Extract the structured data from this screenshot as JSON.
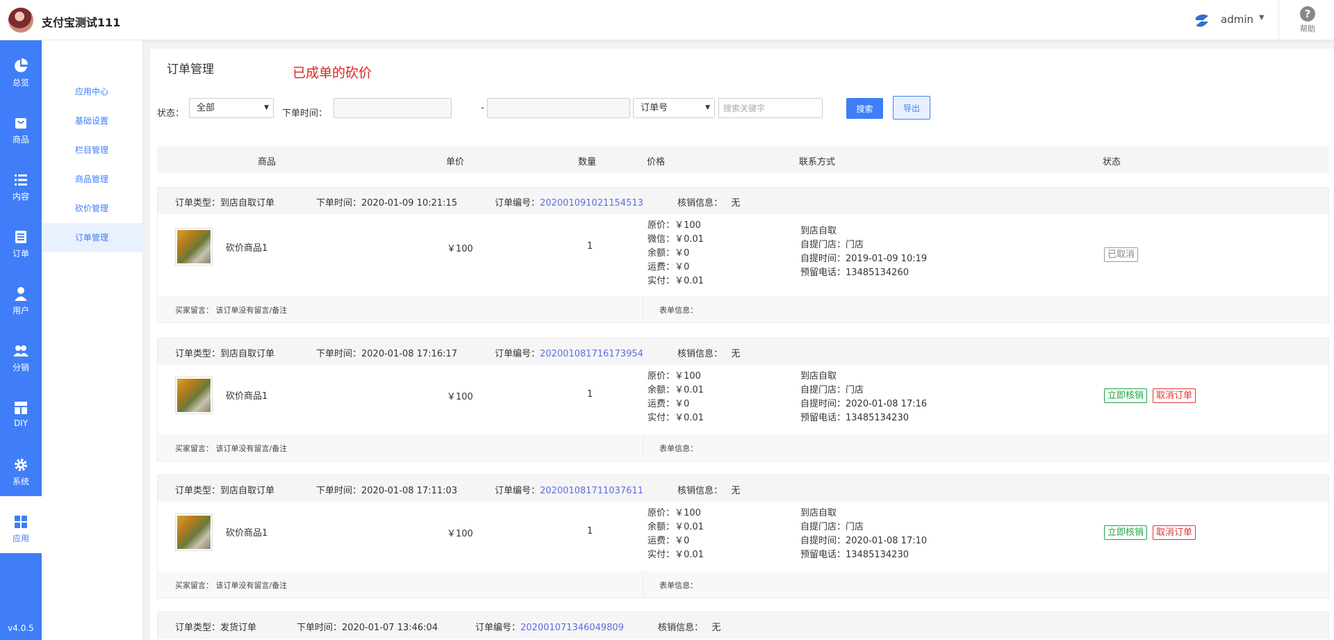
{
  "header": {
    "app_title": "支付宝测试111",
    "user_name": "admin",
    "help_label": "帮助"
  },
  "nav": {
    "items": [
      {
        "label": "总览",
        "icon": "pie-chart-icon"
      },
      {
        "label": "商品",
        "icon": "shopping-bag-icon"
      },
      {
        "label": "内容",
        "icon": "list-icon"
      },
      {
        "label": "订单",
        "icon": "document-icon"
      },
      {
        "label": "用户",
        "icon": "user-icon"
      },
      {
        "label": "分销",
        "icon": "users-icon"
      },
      {
        "label": "DIY",
        "icon": "layout-icon"
      },
      {
        "label": "系统",
        "icon": "gear-icon"
      },
      {
        "label": "应用",
        "icon": "grid-icon"
      }
    ],
    "active": "应用",
    "version": "v4.0.5"
  },
  "submenu": {
    "items": [
      "应用中心",
      "基础设置",
      "栏目管理",
      "商品管理",
      "砍价管理",
      "订单管理"
    ],
    "active": "订单管理"
  },
  "page": {
    "title": "订单管理",
    "note": "已成单的砍价"
  },
  "filters": {
    "status_label": "状态：",
    "status_value": "全部",
    "time_label": "下单时间：",
    "dash": "-",
    "field_value": "订单号",
    "search_placeholder": "搜索关键字",
    "search_button": "搜索",
    "export_button": "导出"
  },
  "table": {
    "columns": [
      "商品",
      "单价",
      "数量",
      "价格",
      "联系方式",
      "状态"
    ]
  },
  "labels": {
    "order_type": "订单类型：",
    "order_time": "下单时间：",
    "order_no": "订单编号：",
    "verify_info": "核销信息：",
    "buyer_note": "买家留言：",
    "form_info": "表单信息："
  },
  "orders": [
    {
      "type": "到店自取订单",
      "time": "2020-01-09 10:21:15",
      "order_no": "202001091021154513",
      "verify": "无",
      "product": "砍价商品1",
      "unit_price": "￥100",
      "qty": "1",
      "price_lines": [
        "原价：￥100",
        "微信：￥0.01",
        "余额：￥0",
        "运费：￥0",
        "实付：￥0.01"
      ],
      "contact_lines": [
        "到店自取",
        "自提门店：门店",
        "自提时间：2019-01-09 10:19",
        "预留电话：13485134260"
      ],
      "status": [
        "已取消"
      ],
      "buyer_note": "该订单没有留言/备注",
      "form_info": ""
    },
    {
      "type": "到店自取订单",
      "time": "2020-01-08 17:16:17",
      "order_no": "202001081716173954",
      "verify": "无",
      "product": "砍价商品1",
      "unit_price": "￥100",
      "qty": "1",
      "price_lines": [
        "原价：￥100",
        "余额：￥0.01",
        "运费：￥0",
        "实付：￥0.01"
      ],
      "contact_lines": [
        "到店自取",
        "自提门店：门店",
        "自提时间：2020-01-08 17:16",
        "预留电话：13485134230"
      ],
      "status": [
        "立即核销",
        "取消订单"
      ],
      "buyer_note": "该订单没有留言/备注",
      "form_info": ""
    },
    {
      "type": "到店自取订单",
      "time": "2020-01-08 17:11:03",
      "order_no": "202001081711037611",
      "verify": "无",
      "product": "砍价商品1",
      "unit_price": "￥100",
      "qty": "1",
      "price_lines": [
        "原价：￥100",
        "余额：￥0.01",
        "运费：￥0",
        "实付：￥0.01"
      ],
      "contact_lines": [
        "到店自取",
        "自提门店：门店",
        "自提时间：2020-01-08 17:10",
        "预留电话：13485134230"
      ],
      "status": [
        "立即核销",
        "取消订单"
      ],
      "buyer_note": "该订单没有留言/备注",
      "form_info": ""
    },
    {
      "type": "发货订单",
      "time": "2020-01-07 13:46:04",
      "order_no": "202001071346049809",
      "verify": "无"
    }
  ]
}
